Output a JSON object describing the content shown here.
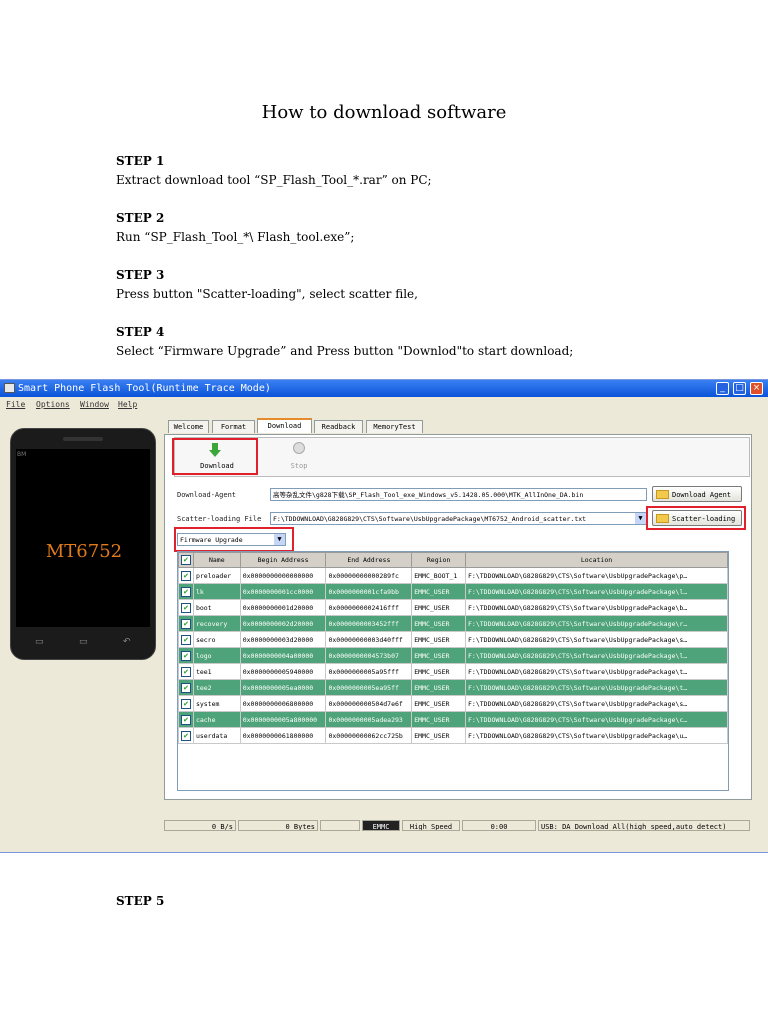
{
  "doc": {
    "title": "How to download software",
    "steps": [
      {
        "heading": "STEP 1",
        "text": "Extract download tool “SP_Flash_Tool_*.rar” on PC;"
      },
      {
        "heading": "STEP 2",
        "text": "Run “SP_Flash_Tool_*\\ Flash_tool.exe”;"
      },
      {
        "heading": "STEP 3",
        "text": "Press button \"Scatter-loading\", select scatter file,"
      },
      {
        "heading": "STEP 4",
        "text": "Select “Firmware Upgrade” and Press button \"Downlod\"to start download;"
      },
      {
        "heading": "STEP 5",
        "text": ""
      }
    ]
  },
  "window": {
    "title": "Smart Phone Flash Tool(Runtime Trace Mode)",
    "menu": [
      "File",
      "Options",
      "Window",
      "Help"
    ],
    "phone": {
      "brand": "BM",
      "model": "MT6752",
      "keys": [
        "▭",
        "▭",
        "↶"
      ]
    },
    "tabs": [
      "Welcome",
      "Format",
      "Download",
      "Readback",
      "MemoryTest"
    ],
    "active_tab": "Download",
    "toolbar": {
      "download_label": "Download",
      "stop_label": "Stop"
    },
    "download_agent": {
      "label": "Download-Agent",
      "value": "高等杂乱文件\\g828下载\\SP_Flash_Tool_exe_Windows_v5.1428.05.000\\MTK_AllInOne_DA.bin",
      "button": "Download Agent"
    },
    "scatter": {
      "label": "Scatter-loading File",
      "value": "F:\\TDDOWNLOAD\\G828G829\\CTS\\Software\\UsbUpgradePackage\\MT6752_Android_scatter.txt",
      "button": "Scatter-loading"
    },
    "mode_select": "Firmware Upgrade",
    "table": {
      "columns": [
        "",
        "Name",
        "Begin Address",
        "End Address",
        "Region",
        "Location"
      ],
      "rows": [
        {
          "name": "preloader",
          "begin": "0x0000000000000000",
          "end": "0x00000000000289fc",
          "region": "EMMC_BOOT_1",
          "location": "F:\\TDDOWNLOAD\\G828G829\\CTS\\Software\\UsbUpgradePackage\\p…"
        },
        {
          "name": "lk",
          "begin": "0x0000000001cc0000",
          "end": "0x0000000001cfa9bb",
          "region": "EMMC_USER",
          "location": "F:\\TDDOWNLOAD\\G828G829\\CTS\\Software\\UsbUpgradePackage\\l…"
        },
        {
          "name": "boot",
          "begin": "0x0000000001d20000",
          "end": "0x0000000002416fff",
          "region": "EMMC_USER",
          "location": "F:\\TDDOWNLOAD\\G828G829\\CTS\\Software\\UsbUpgradePackage\\b…"
        },
        {
          "name": "recovery",
          "begin": "0x0000000002d20000",
          "end": "0x0000000003452fff",
          "region": "EMMC_USER",
          "location": "F:\\TDDOWNLOAD\\G828G829\\CTS\\Software\\UsbUpgradePackage\\r…"
        },
        {
          "name": "secro",
          "begin": "0x0000000003d20000",
          "end": "0x00000000003d40fff",
          "region": "EMMC_USER",
          "location": "F:\\TDDOWNLOAD\\G828G829\\CTS\\Software\\UsbUpgradePackage\\s…"
        },
        {
          "name": "logo",
          "begin": "0x0000000004a00000",
          "end": "0x0000000004573b07",
          "region": "EMMC_USER",
          "location": "F:\\TDDOWNLOAD\\G828G829\\CTS\\Software\\UsbUpgradePackage\\l…"
        },
        {
          "name": "tee1",
          "begin": "0x0000000005940000",
          "end": "0x0000000005a95fff",
          "region": "EMMC_USER",
          "location": "F:\\TDDOWNLOAD\\G828G829\\CTS\\Software\\UsbUpgradePackage\\t…"
        },
        {
          "name": "tee2",
          "begin": "0x0000000005ea0000",
          "end": "0x0000000005ea95ff",
          "region": "EMMC_USER",
          "location": "F:\\TDDOWNLOAD\\G828G829\\CTS\\Software\\UsbUpgradePackage\\t…"
        },
        {
          "name": "system",
          "begin": "0x0000000006800000",
          "end": "0x000000000504d7e6f",
          "region": "EMMC_USER",
          "location": "F:\\TDDOWNLOAD\\G828G829\\CTS\\Software\\UsbUpgradePackage\\s…"
        },
        {
          "name": "cache",
          "begin": "0x0000000005a800000",
          "end": "0x0000000005adea293",
          "region": "EMMC_USER",
          "location": "F:\\TDDOWNLOAD\\G828G829\\CTS\\Software\\UsbUpgradePackage\\c…"
        },
        {
          "name": "userdata",
          "begin": "0x0000000061800000",
          "end": "0x00000000062cc725b",
          "region": "EMMC_USER",
          "location": "F:\\TDDOWNLOAD\\G828G829\\CTS\\Software\\UsbUpgradePackage\\u…"
        }
      ]
    },
    "status": {
      "speed": "0 B/s",
      "bytes": "0 Bytes",
      "storage": "EMMC",
      "usb_speed": "High Speed",
      "time": "0:00",
      "message": "USB: DA Download All(high speed,auto detect)"
    },
    "colors": {
      "title_bar": "#0a53d8",
      "row_highlight": "#4fa37a",
      "callout": "#e0202a",
      "phone_model": "#e07a1a"
    }
  }
}
